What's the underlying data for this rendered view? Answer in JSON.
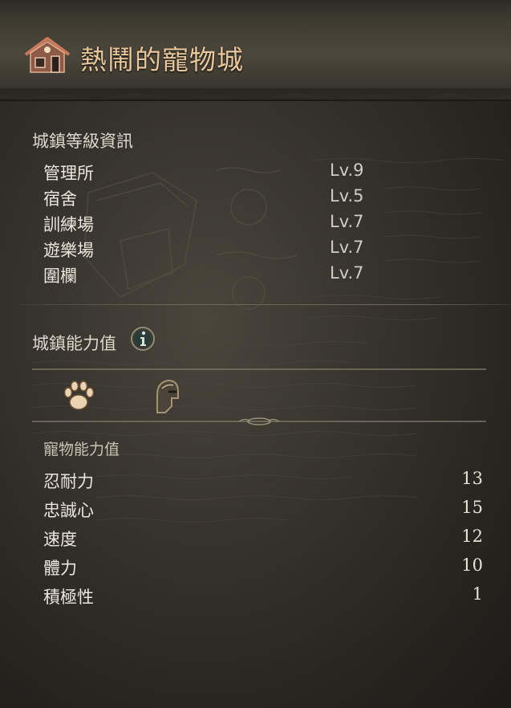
{
  "header": {
    "title": "熱鬧的寵物城"
  },
  "town_level": {
    "heading": "城鎮等級資訊",
    "buildings": [
      {
        "name": "管理所",
        "level": "Lv.9"
      },
      {
        "name": "宿舍",
        "level": "Lv.5"
      },
      {
        "name": "訓練場",
        "level": "Lv.7"
      },
      {
        "name": "遊樂場",
        "level": "Lv.7"
      },
      {
        "name": "圍欄",
        "level": "Lv.7"
      }
    ]
  },
  "town_ability": {
    "heading": "城鎮能力值",
    "icons": [
      "info-icon",
      "paw-icon",
      "helmet-icon"
    ]
  },
  "pet_ability": {
    "heading": "寵物能力值",
    "stats": [
      {
        "name": "忍耐力",
        "value": "13"
      },
      {
        "name": "忠誠心",
        "value": "15"
      },
      {
        "name": "速度",
        "value": "12"
      },
      {
        "name": "體力",
        "value": "10"
      },
      {
        "name": "積極性",
        "value": "1"
      }
    ]
  },
  "colors": {
    "title": "#e8c79a",
    "background": "#36332c"
  }
}
